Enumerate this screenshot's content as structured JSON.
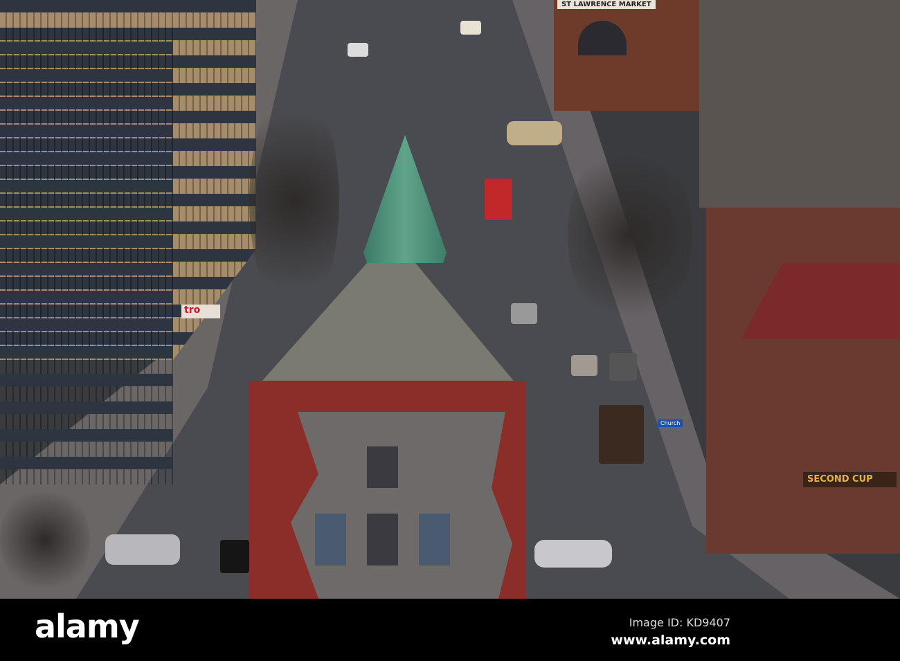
{
  "signs": {
    "market": "ST LAWRENCE MARKET",
    "cafe": "SECOND CUP",
    "street": "Church",
    "store": "tro"
  },
  "watermark": {
    "logo": "alamy",
    "image_id": "Image ID: KD9407",
    "url": "www.alamy.com"
  }
}
